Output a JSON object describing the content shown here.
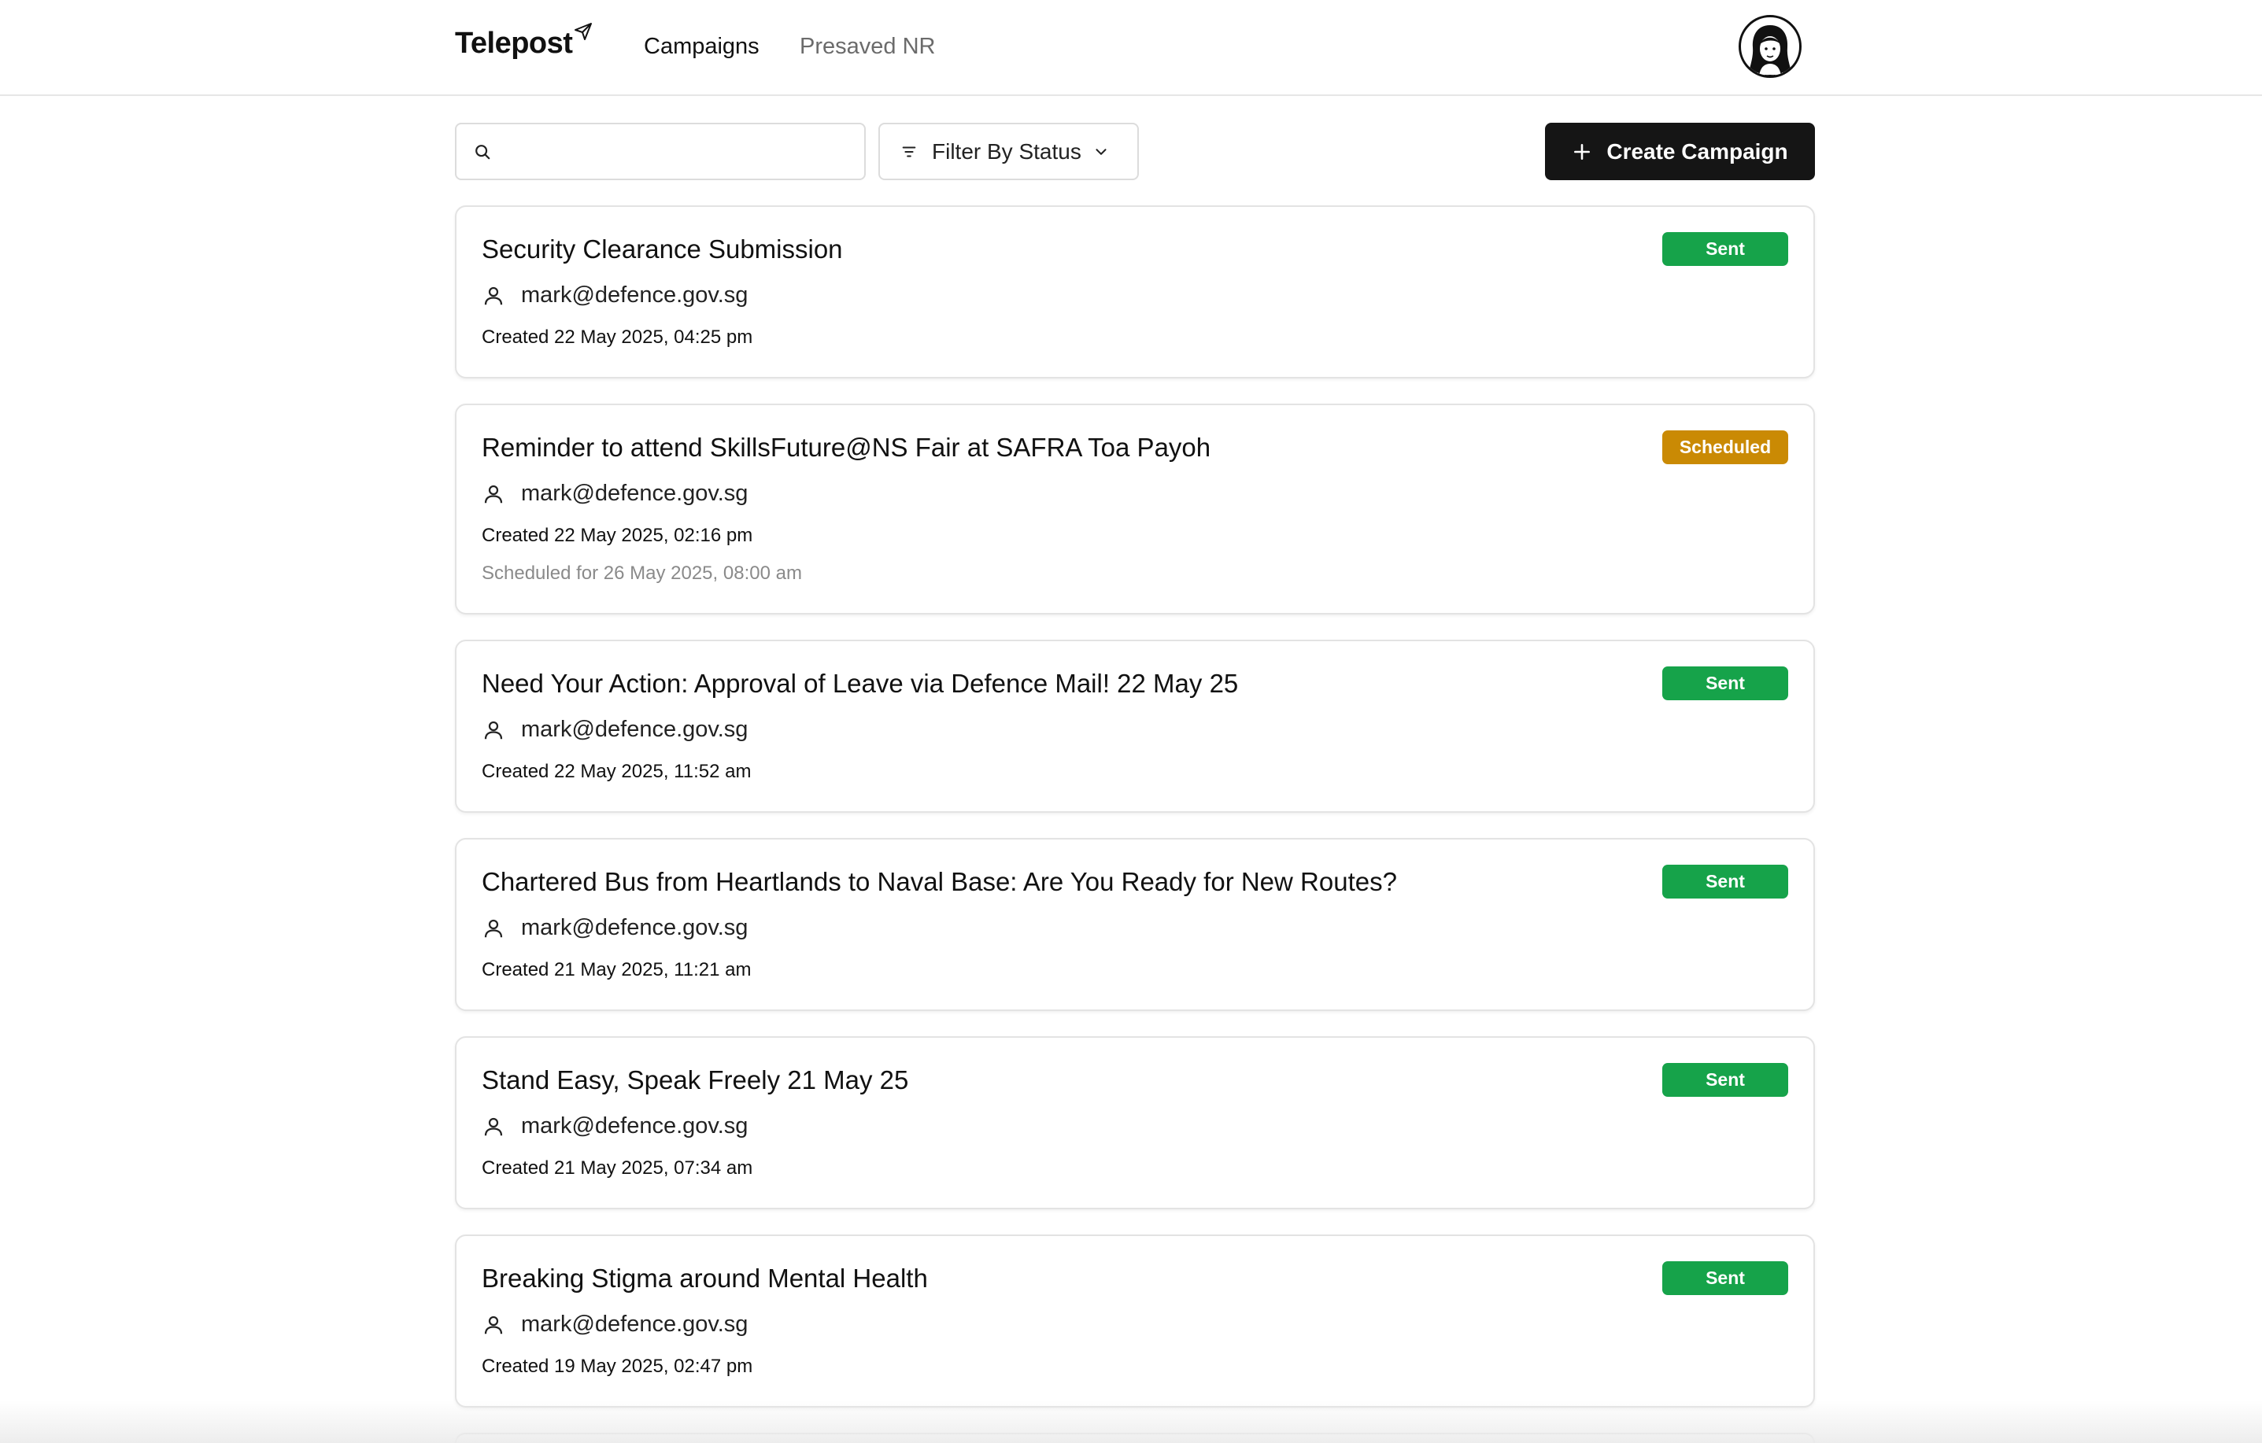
{
  "app": {
    "logo_text": "Telepost",
    "nav": [
      {
        "label": "Campaigns",
        "active": true
      },
      {
        "label": "Presaved NR",
        "active": false
      }
    ]
  },
  "toolbar": {
    "search_placeholder": "",
    "filter_label": "Filter By Status",
    "create_label": "Create Campaign"
  },
  "colors": {
    "sent": "#16a34a",
    "scheduled": "#ca8a04",
    "primary_button": "#151515"
  },
  "campaigns": [
    {
      "title": "Security Clearance Submission",
      "owner": "mark@defence.gov.sg",
      "created": "Created 22 May 2025, 04:25 pm",
      "status": "Sent"
    },
    {
      "title": "Reminder to attend SkillsFuture@NS Fair at SAFRA Toa Payoh",
      "owner": "mark@defence.gov.sg",
      "created": "Created 22 May 2025, 02:16 pm",
      "scheduled": "Scheduled for 26 May 2025, 08:00 am",
      "status": "Scheduled"
    },
    {
      "title": "Need Your Action: Approval of Leave via Defence Mail! 22 May 25",
      "owner": "mark@defence.gov.sg",
      "created": "Created 22 May 2025, 11:52 am",
      "status": "Sent"
    },
    {
      "title": "Chartered Bus from Heartlands to Naval Base: Are You Ready for New Routes?",
      "owner": "mark@defence.gov.sg",
      "created": "Created 21 May 2025, 11:21 am",
      "status": "Sent"
    },
    {
      "title": "Stand Easy, Speak Freely 21 May 25",
      "owner": "mark@defence.gov.sg",
      "created": "Created 21 May 2025, 07:34 am",
      "status": "Sent"
    },
    {
      "title": "Breaking Stigma around Mental Health",
      "owner": "mark@defence.gov.sg",
      "created": "Created 19 May 2025, 02:47 pm",
      "status": "Sent"
    }
  ]
}
